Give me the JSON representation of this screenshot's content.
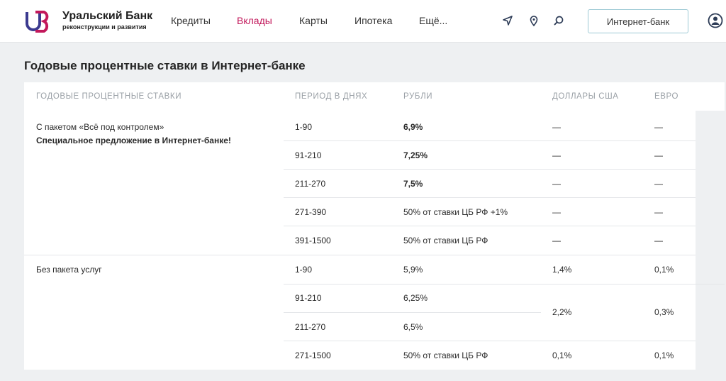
{
  "header": {
    "brand_name": "Уральский Банк",
    "brand_sub": "реконструкции и развития",
    "nav": [
      "Кредиты",
      "Вклады",
      "Карты",
      "Ипотека",
      "Ещё..."
    ],
    "active_nav": "Вклады",
    "login_label": "Интернет-банк",
    "icons": [
      "location-arrow-icon",
      "map-pin-icon",
      "search-icon",
      "profile-icon"
    ],
    "accent_color": "#c2185b",
    "brand_colors": [
      "#3b3a8f",
      "#c2185b"
    ]
  },
  "page_title": "Годовые процентные ставки в Интернет-банке",
  "table": {
    "columns": [
      "Годовые процентные ставки",
      "Период в днях",
      "Рубли",
      "Доллары США",
      "Евро"
    ],
    "groups": [
      {
        "label_line1": "С пакетом «Всё под контролем»",
        "label_line2": "Специальное предложение в Интернет-банке!",
        "rows": [
          {
            "period": "1-90",
            "rub": "6,9%",
            "usd": "—",
            "eur": "—"
          },
          {
            "period": "91-210",
            "rub": "7,25%",
            "usd": "—",
            "eur": "—"
          },
          {
            "period": "211-270",
            "rub": "7,5%",
            "usd": "—",
            "eur": "—"
          },
          {
            "period": "271-390",
            "rub": "50% от ставки ЦБ РФ +1%",
            "usd": "—",
            "eur": "—"
          },
          {
            "period": "391-1500",
            "rub": "50% от ставки ЦБ РФ",
            "usd": "—",
            "eur": "—"
          }
        ]
      },
      {
        "label_line1": "Без пакета услуг",
        "rows": [
          {
            "period": "1-90",
            "rub": "5,9%",
            "usd": "1,4%",
            "eur": "0,1%"
          },
          {
            "period": "91-210",
            "rub": "6,25%"
          },
          {
            "period": "211-270",
            "rub": "6,5%"
          },
          {
            "period": "271-1500",
            "rub": "50% от ставки ЦБ РФ",
            "usd": "0,1%",
            "eur": "0,1%"
          }
        ],
        "merged_usd": "2,2%",
        "merged_eur": "0,3%"
      }
    ]
  }
}
